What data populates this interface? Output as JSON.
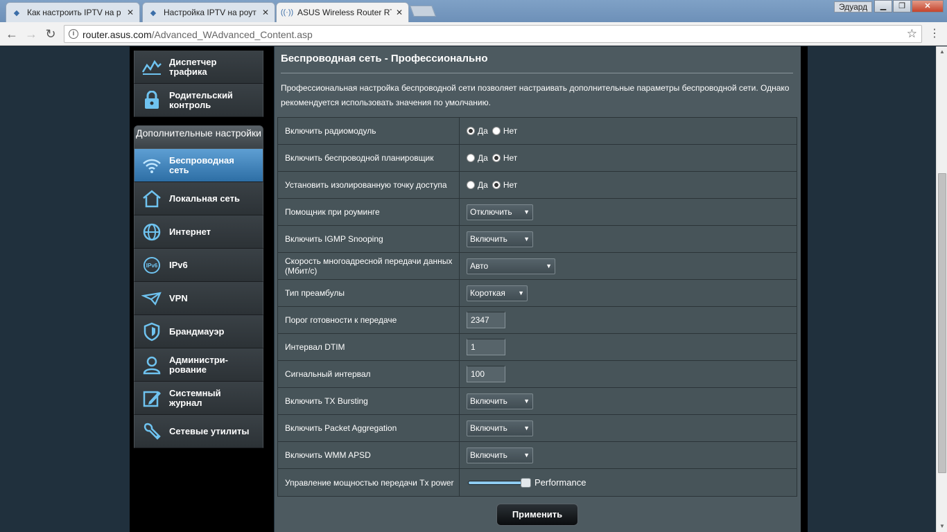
{
  "browser": {
    "tabs": [
      {
        "title": "Как настроить IPTV на р"
      },
      {
        "title": "Настройка IPTV на роут"
      },
      {
        "title": "ASUS Wireless Router RT"
      }
    ],
    "user_name": "Эдуард",
    "url_host": "router.asus.com",
    "url_path": "/Advanced_WAdvanced_Content.asp"
  },
  "sidebar": {
    "top_items": [
      {
        "label": "Диспетчер трафика",
        "icon": "traffic-manager-icon"
      },
      {
        "label": "Родительский контроль",
        "icon": "parental-control-icon"
      }
    ],
    "section_title": "Дополнительные настройки",
    "items": [
      {
        "label": "Беспроводная сеть",
        "icon": "wireless-icon",
        "selected": true
      },
      {
        "label": "Локальная сеть",
        "icon": "lan-icon"
      },
      {
        "label": "Интернет",
        "icon": "internet-icon"
      },
      {
        "label": "IPv6",
        "icon": "ipv6-icon"
      },
      {
        "label": "VPN",
        "icon": "vpn-icon"
      },
      {
        "label": "Брандмауэр",
        "icon": "firewall-icon"
      },
      {
        "label": "Администри-рование",
        "icon": "administration-icon"
      },
      {
        "label": "Системный журнал",
        "icon": "system-log-icon"
      },
      {
        "label": "Сетевые утилиты",
        "icon": "network-tools-icon"
      }
    ]
  },
  "main": {
    "title": "Беспроводная сеть - Профессионально",
    "description": "Профессиональная настройка беспроводной сети позволяет настраивать дополнительные параметры беспроводной сети. Однако рекомендуется использовать значения по умолчанию.",
    "radio_yes": "Да",
    "radio_no": "Нет",
    "settings": {
      "radio_module": {
        "label": "Включить радиомодуль",
        "value": "Да"
      },
      "scheduler": {
        "label": "Включить беспроводной планировщик",
        "value": "Нет"
      },
      "isolated_ap": {
        "label": "Установить изолированную точку доступа",
        "value": "Нет"
      },
      "roaming": {
        "label": "Помощник при роуминге",
        "value": "Отключить"
      },
      "igmp": {
        "label": "Включить IGMP Snooping",
        "value": "Включить"
      },
      "multicast_rate": {
        "label": "Скорость многоадресной передачи данных (Мбит/с)",
        "value": "Авто"
      },
      "preamble": {
        "label": "Тип преамбулы",
        "value": "Короткая"
      },
      "rts": {
        "label": "Порог готовности к передаче",
        "value": "2347"
      },
      "dtim": {
        "label": "Интервал DTIM",
        "value": "1"
      },
      "beacon": {
        "label": "Сигнальный интервал",
        "value": "100"
      },
      "tx_bursting": {
        "label": "Включить TX Bursting",
        "value": "Включить"
      },
      "packet_aggregation": {
        "label": "Включить Packet Aggregation",
        "value": "Включить"
      },
      "wmm_apsd": {
        "label": "Включить WMM APSD",
        "value": "Включить"
      },
      "tx_power": {
        "label": "Управление мощностью передачи Tx power",
        "value_text": "Performance",
        "level": 1.0
      }
    },
    "apply_label": "Применить"
  },
  "colors": {
    "accent": "#4a90c9",
    "panel": "#475459",
    "background": "#4d5a60"
  }
}
